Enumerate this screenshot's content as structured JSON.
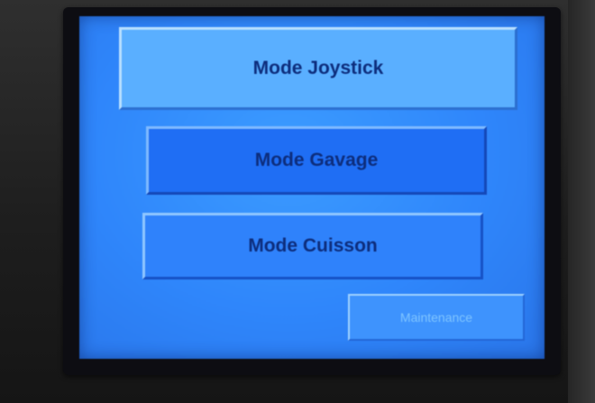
{
  "menu": {
    "joystick_label": "Mode Joystick",
    "gavage_label": "Mode Gavage",
    "cuisson_label": "Mode Cuisson",
    "maintenance_label": "Maintenance"
  },
  "colors": {
    "screen_background": "#2f86fb",
    "highlighted_button": "#5aafff",
    "button": "#1f6ef4",
    "label_text": "#0d2d7c",
    "disabled_text": "#7ec4ff"
  }
}
